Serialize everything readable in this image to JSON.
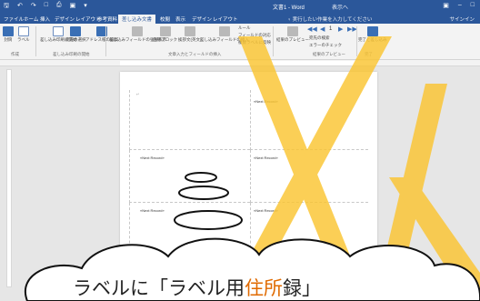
{
  "titlebar": {
    "title": "文書1 - Word",
    "user": "表示へ",
    "qat_icons": [
      "save-icon",
      "undo-icon",
      "redo-icon",
      "new-icon",
      "print-icon",
      "zoom-icon"
    ]
  },
  "tabs": [
    {
      "label": "ファイル"
    },
    {
      "label": "ホーム"
    },
    {
      "label": "挿入"
    },
    {
      "label": "デザイン"
    },
    {
      "label": "レイアウト"
    },
    {
      "label": "参考資料"
    },
    {
      "label": "差し込み文書",
      "active": true
    },
    {
      "label": "校閲"
    },
    {
      "label": "表示"
    },
    {
      "label": "デザイン"
    },
    {
      "label": "レイアウト"
    }
  ],
  "tell_me": "♀ 実行したい作業を入力してください",
  "signin": "サインイン",
  "ribbon": {
    "buttons": [
      {
        "label": "封筒"
      },
      {
        "label": "ラベル"
      },
      {
        "label": "差し込み印刷の開始"
      },
      {
        "label": "宛先の選択"
      },
      {
        "label": "アドレス帳の編集"
      },
      {
        "label": "差し込みフィールドの強調表示"
      },
      {
        "label": "住所ブロック"
      },
      {
        "label": "挨拶文(英文)"
      },
      {
        "label": "差し込みフィールドの挿入"
      },
      {
        "label": "ルール"
      },
      {
        "label": "フィールドの対応"
      },
      {
        "label": "複数ラベルに反映"
      },
      {
        "label": "結果のプレビュー"
      },
      {
        "label": "宛先の検索"
      },
      {
        "label": "エラーのチェック"
      },
      {
        "label": "完了と差し込み"
      }
    ],
    "groups": [
      {
        "label": "作成"
      },
      {
        "label": "差し込み印刷の開始"
      },
      {
        "label": "文章入力とフィールドの挿入"
      },
      {
        "label": "結果のプレビュー"
      },
      {
        "label": "完了"
      }
    ],
    "record_number": "1"
  },
  "document": {
    "records": [
      "«Next Record»",
      "«Next Record»",
      "«Next Record»",
      "«Next Record»",
      "«Next Record»"
    ]
  },
  "overlay": {
    "caption_before": "ラベルに「ラベル用",
    "caption_highlight": "住所",
    "caption_after": "録」",
    "accent_color": "#fbc531"
  }
}
